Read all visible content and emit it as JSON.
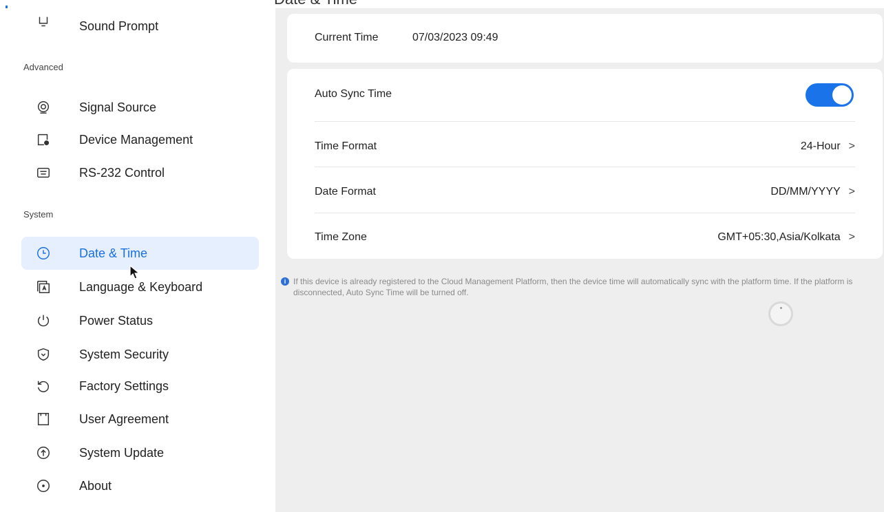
{
  "top_heading_partial": "Date & Time",
  "sidebar": {
    "items_top": [
      {
        "label": "Sound Prompt",
        "icon": "speaker-icon"
      }
    ],
    "section_advanced": "Advanced",
    "items_advanced": [
      {
        "label": "Signal Source",
        "icon": "signal-source-icon"
      },
      {
        "label": "Device Management",
        "icon": "device-management-icon"
      },
      {
        "label": "RS-232 Control",
        "icon": "rs232-icon"
      }
    ],
    "section_system": "System",
    "items_system": [
      {
        "label": "Date & Time",
        "icon": "clock-icon",
        "active": true
      },
      {
        "label": "Language & Keyboard",
        "icon": "keyboard-icon"
      },
      {
        "label": "Power Status",
        "icon": "power-icon"
      },
      {
        "label": "System Security",
        "icon": "shield-icon"
      },
      {
        "label": "Factory Settings",
        "icon": "reset-icon"
      },
      {
        "label": "User Agreement",
        "icon": "document-icon"
      },
      {
        "label": "System Update",
        "icon": "update-icon"
      },
      {
        "label": "About",
        "icon": "info-icon"
      }
    ]
  },
  "main": {
    "current_time_label": "Current Time",
    "current_time_value": "07/03/2023 09:49",
    "auto_sync_label": "Auto Sync Time",
    "auto_sync_on": true,
    "time_format_label": "Time Format",
    "time_format_value": "24-Hour",
    "date_format_label": "Date Format",
    "date_format_value": "DD/MM/YYYY",
    "time_zone_label": "Time Zone",
    "time_zone_value": "GMT+05:30,Asia/Kolkata",
    "chevron": ">",
    "note": "If this device is already registered to the Cloud Management Platform, then the device time will automatically sync with the platform time. If the platform is disconnected, Auto Sync Time will be turned off."
  },
  "colors": {
    "accent": "#1a73e8",
    "active_bg": "#e6effd",
    "main_bg": "#eeeeef"
  }
}
